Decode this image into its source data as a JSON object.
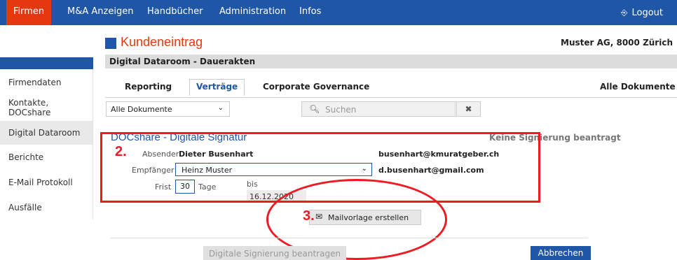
{
  "nav": {
    "items": [
      {
        "label": "Firmen",
        "active": true
      },
      {
        "label": "M&A Anzeigen"
      },
      {
        "label": "Handbücher"
      },
      {
        "label": "Administration"
      },
      {
        "label": "Infos"
      }
    ],
    "logout": "Logout",
    "logout_icon": "logout-icon"
  },
  "sidebar": {
    "items": [
      {
        "label": "Firmendaten"
      },
      {
        "label": "Kontakte,"
      },
      {
        "label": "DOCshare"
      },
      {
        "label": "Digital Dataroom",
        "active": true
      },
      {
        "label": "Berichte"
      },
      {
        "label": "E-Mail Protokoll"
      },
      {
        "label": "Ausfälle"
      }
    ]
  },
  "header": {
    "title": "Kundeneintrag",
    "company": "Muster AG, 8000 Zürich",
    "subtitle": "Digital Dataroom - Dauerakten"
  },
  "tabs": [
    {
      "label": "Reporting"
    },
    {
      "label": "Verträge",
      "active": true
    },
    {
      "label": "Corporate Governance"
    },
    {
      "label": "Alle Dokumente"
    }
  ],
  "filters": {
    "select_value": "Alle Dokumente",
    "search_placeholder": "Suchen",
    "clear_icon": "✖"
  },
  "docshare": {
    "title": "DOCshare - Digitale Signatur",
    "status": "Keine Signierung beantragt",
    "absender_label": "Absender",
    "absender_name": "Dieter Busenhart",
    "absender_email": "busenhart@kmuratgeber.ch",
    "empfaenger_label": "Empfänger",
    "empfaenger_value": "Heinz Muster",
    "empfaenger_email": "d.busenhart@gmail.com",
    "frist_label": "Frist",
    "frist_value": "30",
    "tage_label": "Tage",
    "bis_label": "bis",
    "bis_date": "16.12.2020"
  },
  "annotations": {
    "step2": "2.",
    "step3": "3."
  },
  "mail_button": "Mailvorlage erstellen",
  "footer": {
    "sign_button": "Digitale Signierung beantragen",
    "cancel_button": "Abbrechen"
  },
  "colors": {
    "primary": "#1f57a6",
    "accent": "#e6380f",
    "annotation": "#ee1b24"
  }
}
